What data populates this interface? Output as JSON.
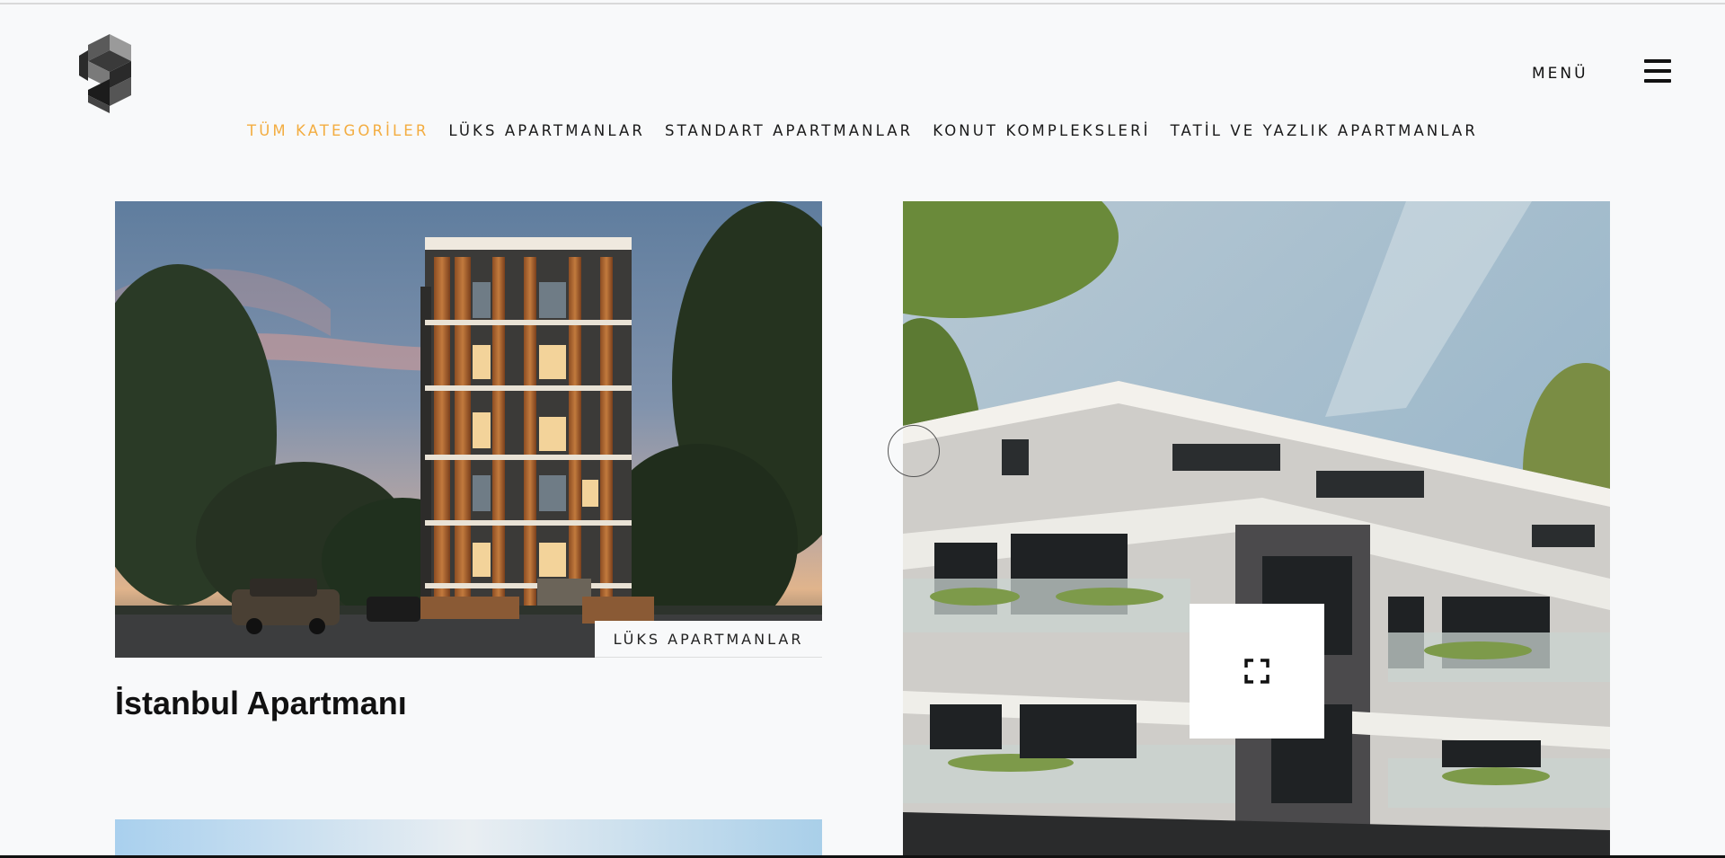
{
  "header": {
    "menu_label": "MENÜ"
  },
  "categories": [
    {
      "label": "TÜM KATEGORİLER",
      "active": true
    },
    {
      "label": "LÜKS APARTMANLAR",
      "active": false
    },
    {
      "label": "STANDART APARTMANLAR",
      "active": false
    },
    {
      "label": "KONUT KOMPLEKSLERİ",
      "active": false
    },
    {
      "label": "TATİL VE YAZLIK APARTMANLAR",
      "active": false
    }
  ],
  "projects": [
    {
      "category": "LÜKS APARTMANLAR",
      "title": "İstanbul Apartmanı"
    }
  ],
  "icons": {
    "logo": "brand-logo-icon",
    "hamburger": "hamburger-menu-icon",
    "expand": "expand-icon"
  },
  "colors": {
    "accent": "#f3ad41",
    "text": "#111111",
    "background": "#f8f9fa"
  }
}
